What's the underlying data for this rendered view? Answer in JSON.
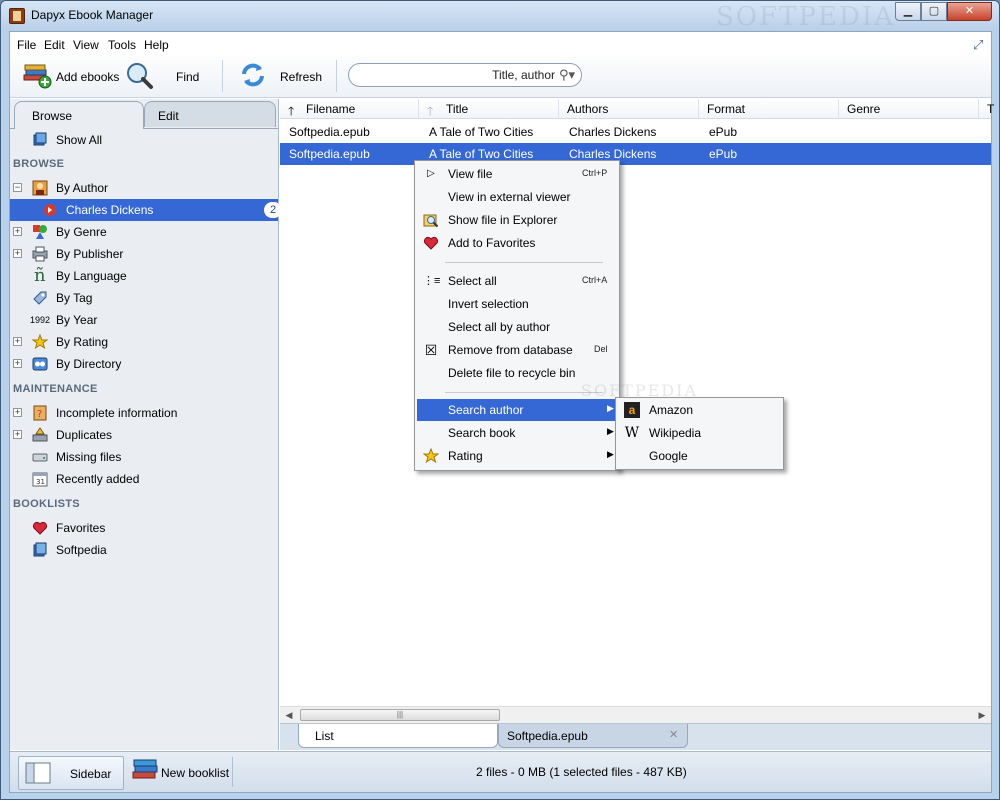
{
  "window": {
    "title": "Dapyx Ebook Manager",
    "watermark": "SOFTPEDIA"
  },
  "menubar": [
    "File",
    "Edit",
    "View",
    "Tools",
    "Help"
  ],
  "toolbar": {
    "add_label": "Add ebooks",
    "find_label": "Find",
    "refresh_label": "Refresh",
    "search_placeholder": "Title, author"
  },
  "sidebar": {
    "tabs": [
      "Browse",
      "Edit"
    ],
    "show_all": "Show All",
    "browse_header": "BROWSE",
    "browse_items": [
      "By Author",
      "By Genre",
      "By Publisher",
      "By Language",
      "By Tag",
      "By Year",
      "By Rating",
      "By Directory"
    ],
    "author_child": "Charles Dickens",
    "author_child_count": "2",
    "year_icon_text": "1992",
    "language_icon_text": "ñ",
    "maintenance_header": "MAINTENANCE",
    "maintenance_items": [
      "Incomplete information",
      "Duplicates",
      "Missing files",
      "Recently added"
    ],
    "booklists_header": "BOOKLISTS",
    "booklist_items": [
      "Favorites",
      "Softpedia"
    ]
  },
  "list": {
    "columns": [
      "Filename",
      "Title",
      "Authors",
      "Format",
      "Genre",
      "T"
    ],
    "rows": [
      {
        "filename": "Softpedia.epub",
        "title": "A Tale of Two Cities",
        "authors": "Charles Dickens",
        "format": "ePub"
      },
      {
        "filename": "Softpedia.epub",
        "title": "A Tale of Two Cities",
        "authors": "Charles Dickens",
        "format": "ePub"
      }
    ]
  },
  "doc_tabs": [
    "List",
    "Softpedia.epub"
  ],
  "status": {
    "sidebar_label": "Sidebar",
    "new_booklist_label": "New booklist",
    "text": "2 files - 0 MB (1 selected files - 487 KB)"
  },
  "context_menu": {
    "items": [
      {
        "label": "View file",
        "shortcut": "Ctrl+P"
      },
      {
        "label": "View in external viewer"
      },
      {
        "label": "Show file in Explorer"
      },
      {
        "label": "Add to Favorites"
      },
      {
        "label": "Select all",
        "shortcut": "Ctrl+A"
      },
      {
        "label": "Invert selection"
      },
      {
        "label": "Select all by author"
      },
      {
        "label": "Remove from database",
        "shortcut": "Del"
      },
      {
        "label": "Delete file to recycle bin"
      },
      {
        "label": "Search author"
      },
      {
        "label": "Search book"
      },
      {
        "label": "Rating"
      }
    ],
    "submenu": [
      "Amazon",
      "Wikipedia",
      "Google"
    ]
  },
  "colors": {
    "selection": "#3568d4",
    "window_frame": "#b9d1ea"
  }
}
